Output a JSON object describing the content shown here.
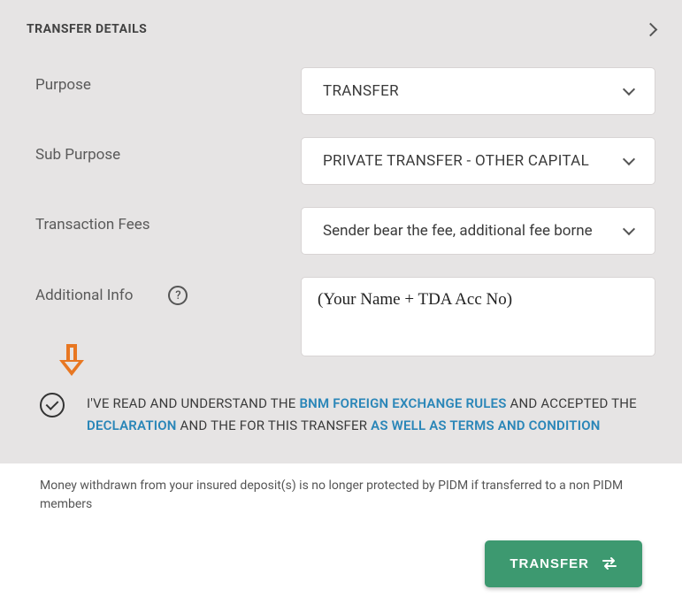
{
  "header": {
    "title": "TRANSFER DETAILS"
  },
  "fields": {
    "purpose": {
      "label": "Purpose",
      "value": "TRANSFER"
    },
    "subPurpose": {
      "label": "Sub Purpose",
      "value": "PRIVATE TRANSFER - OTHER CAPITAL"
    },
    "txnFees": {
      "label": "Transaction Fees",
      "value": "Sender bear the fee, additional fee borne"
    },
    "addInfo": {
      "label": "Additional Info",
      "value": "(Your Name + TDA Acc No)"
    }
  },
  "consent": {
    "part1": "I'VE READ AND UNDERSTAND THE ",
    "link1": "BNM FOREIGN EXCHANGE RULES",
    "part2": " AND ACCEPTED THE ",
    "link2": "DECLARATION",
    "part3": " AND THE FOR THIS TRANSFER ",
    "link3": "AS WELL AS TERMS AND CONDITION"
  },
  "disclaimer": "Money withdrawn from your insured deposit(s) is no longer protected by PIDM if transferred to a non PIDM members",
  "buttons": {
    "transfer": "TRANSFER"
  }
}
